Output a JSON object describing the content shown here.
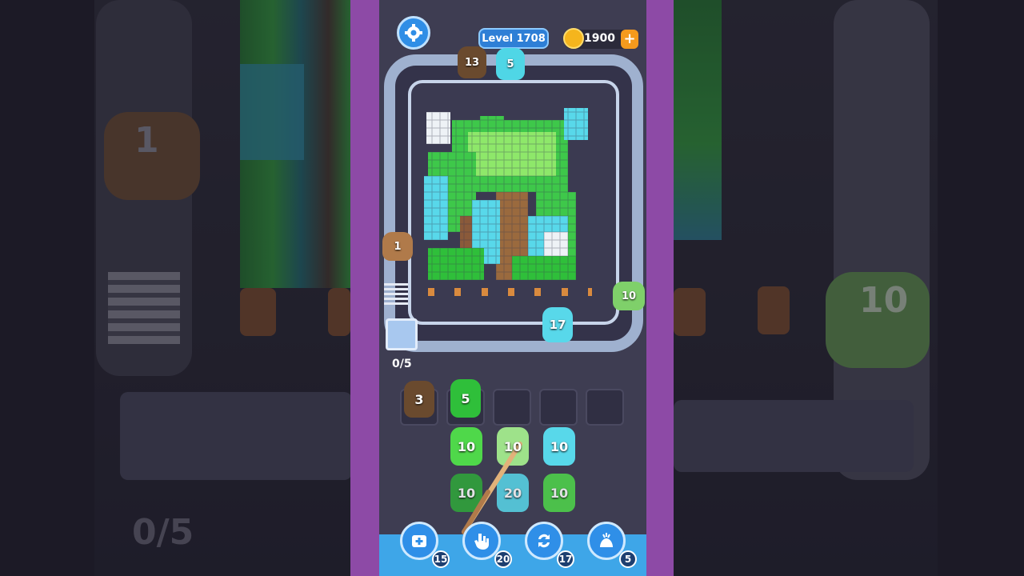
{
  "header": {
    "level_label": "Level 1708",
    "coins": "1900",
    "coin_plus": "+"
  },
  "conveyor_pigs": [
    {
      "count": "13",
      "color": "#6a4a2e"
    },
    {
      "count": "5",
      "color": "#4fd6e6"
    },
    {
      "count": "1",
      "color": "#b07a4a"
    },
    {
      "count": "10",
      "color": "#7fd06a"
    },
    {
      "count": "17",
      "color": "#58d8ea"
    }
  ],
  "queue_counter": "0/5",
  "slots": [
    {
      "count": "3",
      "color": "#6a4a2e"
    },
    {
      "count": "5",
      "color": "#2fbf3a"
    },
    {
      "count": "",
      "color": ""
    },
    {
      "count": "",
      "color": ""
    },
    {
      "count": "",
      "color": ""
    }
  ],
  "grid_pigs": [
    {
      "count": "10",
      "color": "#4fd84a"
    },
    {
      "count": "10",
      "color": "#9ee28a"
    },
    {
      "count": "10",
      "color": "#58d8ea"
    },
    {
      "count": "10",
      "color": "#2fa83a"
    },
    {
      "count": "20",
      "color": "#58d8ea"
    },
    {
      "count": "10",
      "color": "#4fd84a"
    }
  ],
  "boosters": [
    {
      "name": "add-slot",
      "count": "15"
    },
    {
      "name": "hand",
      "count": "20"
    },
    {
      "name": "shuffle",
      "count": "17"
    },
    {
      "name": "magic",
      "count": "5"
    }
  ],
  "background_blur": {
    "pig_left_count": "1",
    "pig_right_count": "10",
    "counter": "0/5"
  },
  "colors": {
    "accent_blue": "#2f8ee6",
    "purple_frame": "#8d4aa6",
    "track": "#9fb1cf"
  }
}
